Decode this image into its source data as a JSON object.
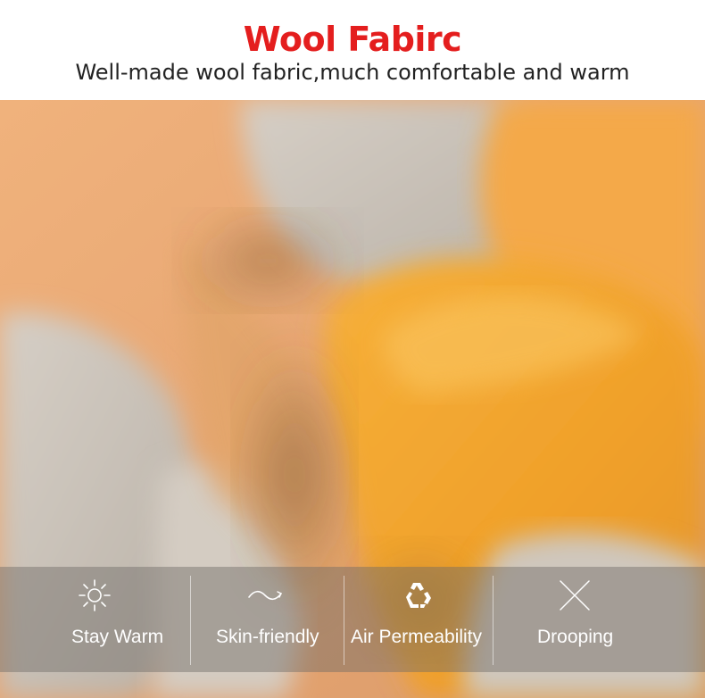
{
  "header": {
    "title": "Wool Fabirc",
    "subtitle": "Well-made wool fabric,much comfortable and warm"
  },
  "colors": {
    "title": "#e41e1e",
    "subtitle": "#222222",
    "bar_overlay": "#6e6a66",
    "wool_orange": "#f0a430",
    "wool_peach": "#e8b07a",
    "wool_grey": "#c9c2b9"
  },
  "features": [
    {
      "label": "Stay Warm",
      "icon": "sun-icon"
    },
    {
      "label": "Skin-friendly",
      "icon": "wave-icon"
    },
    {
      "label": "Air Permeability",
      "icon": "recycle-icon"
    },
    {
      "label": "Drooping",
      "icon": "cross-icon"
    }
  ]
}
